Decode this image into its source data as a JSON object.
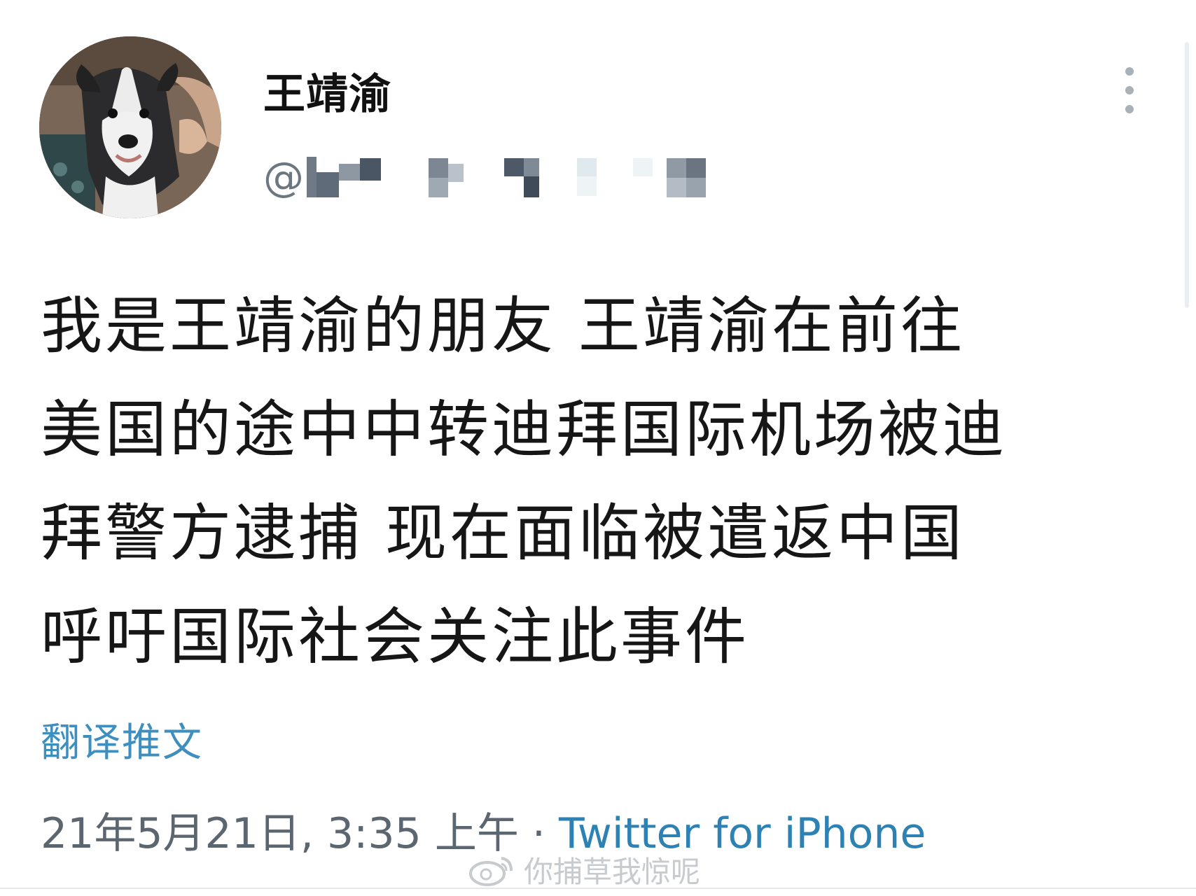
{
  "tweet": {
    "display_name": "王靖渝",
    "handle_prefix": "@",
    "body_lines": [
      "我是王靖渝的朋友  王靖渝在前往",
      "美国的途中中转迪拜国际机场被迪",
      "拜警方逮捕  现在面临被遣返中国",
      "呼吁国际社会关注此事件"
    ],
    "translate_label": "翻译推文",
    "timestamp": "21年5月21日, 3:35 上午",
    "separator": " · ",
    "source": "Twitter for iPhone"
  },
  "watermark": {
    "text": "你捕草我惊呢"
  },
  "icons": {
    "more": "more-vertical-icon",
    "avatar": "dog-photo-avatar",
    "watermark_logo": "weibo-logo-icon"
  },
  "colors": {
    "text": "#161616",
    "link": "#2d82b3",
    "muted": "#5c6670"
  }
}
